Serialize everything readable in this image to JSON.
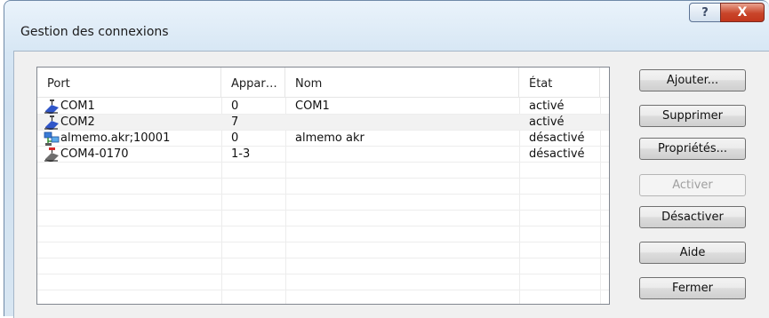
{
  "window": {
    "title": "Gestion des connexions",
    "help_label": "?",
    "close_label": "X"
  },
  "table": {
    "columns": [
      "Port",
      "Appar…",
      "Nom",
      "État"
    ],
    "rows": [
      {
        "port": "COM1",
        "appareils": "0",
        "nom": "COM1",
        "etat": "activé",
        "icon": "serial-port-icon"
      },
      {
        "port": "COM2",
        "appareils": "7",
        "nom": "",
        "etat": "activé",
        "icon": "serial-port-icon"
      },
      {
        "port": "almemo.akr;10001",
        "appareils": "0",
        "nom": "almemo akr",
        "etat": "désactivé",
        "icon": "network-port-icon"
      },
      {
        "port": "COM4-0170",
        "appareils": "1-3",
        "nom": "",
        "etat": "désactivé",
        "icon": "serial-port-disabled-icon"
      }
    ]
  },
  "buttons": {
    "add": "Ajouter...",
    "delete": "Supprimer",
    "properties": "Propriétés...",
    "activate": "Activer",
    "deactivate": "Désactiver",
    "help": "Aide",
    "close": "Fermer"
  }
}
